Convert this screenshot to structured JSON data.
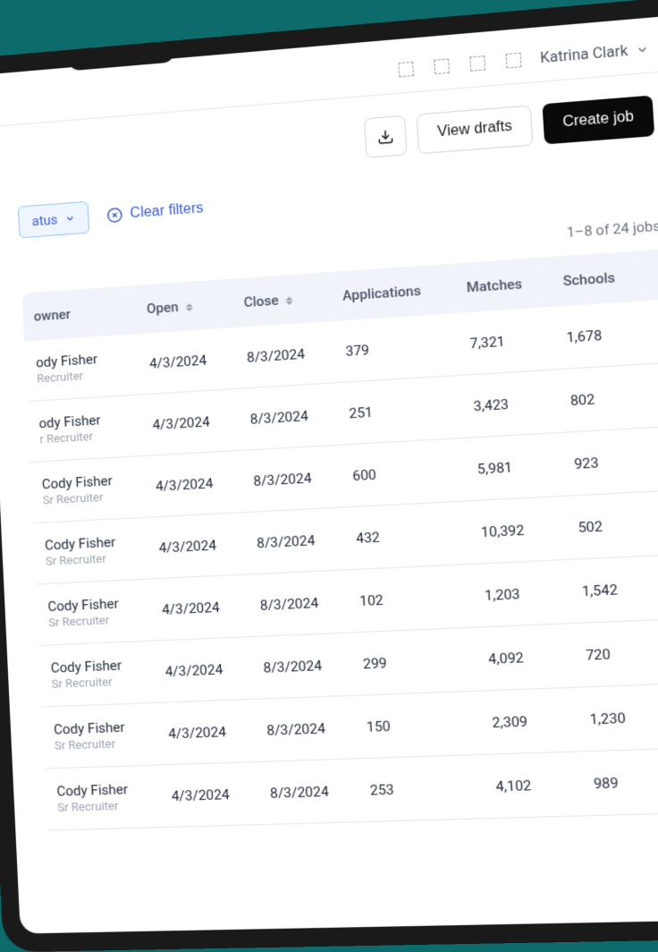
{
  "header": {
    "user_name": "Katrina Clark"
  },
  "actions": {
    "view_drafts": "View drafts",
    "create_job": "Create job"
  },
  "filters": {
    "status_label": "atus",
    "clear_label": "Clear filters"
  },
  "pagination": {
    "summary": "1–8 of 24 jobs"
  },
  "table": {
    "headers": {
      "owner": "owner",
      "open": "Open",
      "close": "Close",
      "applications": "Applications",
      "matches": "Matches",
      "schools": "Schools"
    },
    "rows": [
      {
        "owner_name": "ody Fisher",
        "owner_role": "Recruiter",
        "open": "4/3/2024",
        "close": "8/3/2024",
        "applications": "379",
        "matches": "7,321",
        "schools": "1,678"
      },
      {
        "owner_name": "ody Fisher",
        "owner_role": "r Recruiter",
        "open": "4/3/2024",
        "close": "8/3/2024",
        "applications": "251",
        "matches": "3,423",
        "schools": "802"
      },
      {
        "owner_name": "Cody Fisher",
        "owner_role": "Sr Recruiter",
        "open": "4/3/2024",
        "close": "8/3/2024",
        "applications": "600",
        "matches": "5,981",
        "schools": "923"
      },
      {
        "owner_name": "Cody Fisher",
        "owner_role": "Sr Recruiter",
        "open": "4/3/2024",
        "close": "8/3/2024",
        "applications": "432",
        "matches": "10,392",
        "schools": "502"
      },
      {
        "owner_name": "Cody Fisher",
        "owner_role": "Sr Recruiter",
        "open": "4/3/2024",
        "close": "8/3/2024",
        "applications": "102",
        "matches": "1,203",
        "schools": "1,542"
      },
      {
        "owner_name": "Cody Fisher",
        "owner_role": "Sr Recruiter",
        "open": "4/3/2024",
        "close": "8/3/2024",
        "applications": "299",
        "matches": "4,092",
        "schools": "720"
      },
      {
        "owner_name": "Cody Fisher",
        "owner_role": "Sr Recruiter",
        "open": "4/3/2024",
        "close": "8/3/2024",
        "applications": "150",
        "matches": "2,309",
        "schools": "1,230"
      },
      {
        "owner_name": "Cody Fisher",
        "owner_role": "Sr Recruiter",
        "open": "4/3/2024",
        "close": "8/3/2024",
        "applications": "253",
        "matches": "4,102",
        "schools": "989"
      }
    ]
  }
}
